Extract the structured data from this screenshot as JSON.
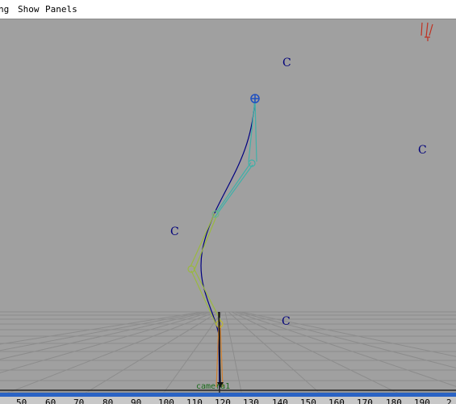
{
  "menubar": {
    "items": [
      {
        "label": "ng"
      },
      {
        "label": "Show"
      },
      {
        "label": "Panels"
      }
    ]
  },
  "viewport": {
    "locators": [
      "C",
      "C",
      "C",
      "C"
    ],
    "camera_label": "camera1",
    "colors": {
      "background": "#a0a0a0",
      "grid": "#8d8d8d",
      "curve": "#000080",
      "joint_chain_upper": "#40b0a8",
      "joint_chain_lower": "#9ab840",
      "root_joint": "#d08030",
      "ik_handle": "#2050c0",
      "locator_text": "#00007a",
      "axis_icon": "#c03020"
    }
  },
  "timeline": {
    "ticks": [
      "50",
      "60",
      "70",
      "80",
      "90",
      "100",
      "110",
      "120",
      "130",
      "140",
      "150",
      "160",
      "170",
      "180",
      "190",
      "2"
    ]
  }
}
